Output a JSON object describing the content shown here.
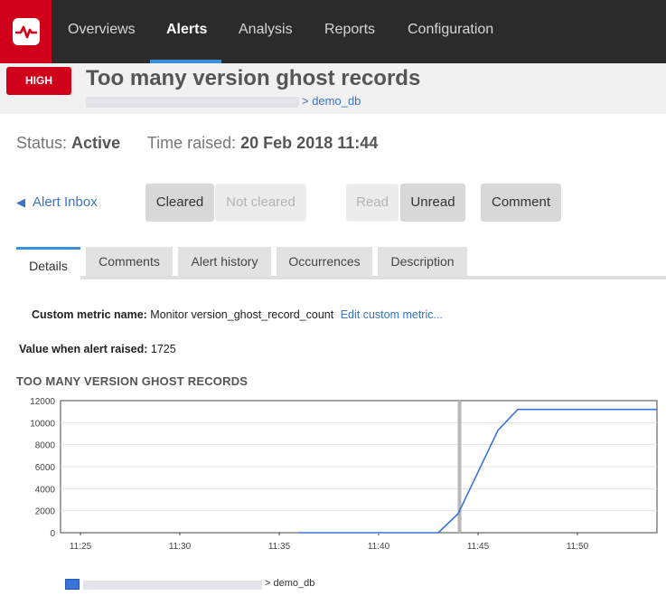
{
  "nav": {
    "items": [
      {
        "label": "Overviews"
      },
      {
        "label": "Alerts"
      },
      {
        "label": "Analysis"
      },
      {
        "label": "Reports"
      },
      {
        "label": "Configuration"
      }
    ],
    "active": "Alerts"
  },
  "alert": {
    "severity": "HIGH",
    "title": "Too many version ghost records",
    "server_path": "> demo_db"
  },
  "status": {
    "status_label": "Status:",
    "status_value": "Active",
    "time_label": "Time raised:",
    "time_value": "20 Feb 2018 11:44"
  },
  "actions": {
    "inbox_label": "Alert Inbox",
    "cleared": "Cleared",
    "not_cleared": "Not cleared",
    "read": "Read",
    "unread": "Unread",
    "comment": "Comment"
  },
  "tabs": [
    {
      "label": "Details"
    },
    {
      "label": "Comments"
    },
    {
      "label": "Alert history"
    },
    {
      "label": "Occurrences"
    },
    {
      "label": "Description"
    }
  ],
  "details": {
    "metric_label": "Custom metric name:",
    "metric_value": "Monitor version_ghost_record_count",
    "metric_edit": "Edit custom metric...",
    "value_label": "Value when alert raised:",
    "value": "1725"
  },
  "chart_title": "TOO MANY VERSION GHOST RECORDS",
  "legend": {
    "label": "> demo_db"
  },
  "colors": {
    "accent": "#3d8fd9",
    "brand_red": "#d0021b",
    "series": "#3b74d9",
    "marker": "#b8b8b8"
  },
  "chart_data": {
    "type": "line",
    "title": "TOO MANY VERSION GHOST RECORDS",
    "xlabel": "",
    "ylabel": "",
    "xlim": [
      "11:24",
      "11:54"
    ],
    "ylim": [
      0,
      12000
    ],
    "x_ticks": [
      "11:25",
      "11:30",
      "11:35",
      "11:40",
      "11:45",
      "11:50"
    ],
    "y_ticks": [
      0,
      2000,
      4000,
      6000,
      8000,
      10000,
      12000
    ],
    "alert_marker": "11:44",
    "series": [
      {
        "name": "> demo_db",
        "x": [
          "11:36",
          "11:43",
          "11:44",
          "11:46",
          "11:47",
          "11:54"
        ],
        "values": [
          0,
          0,
          1725,
          9300,
          11200,
          11200
        ]
      }
    ],
    "grid": true,
    "legend_position": "bottom-left"
  }
}
